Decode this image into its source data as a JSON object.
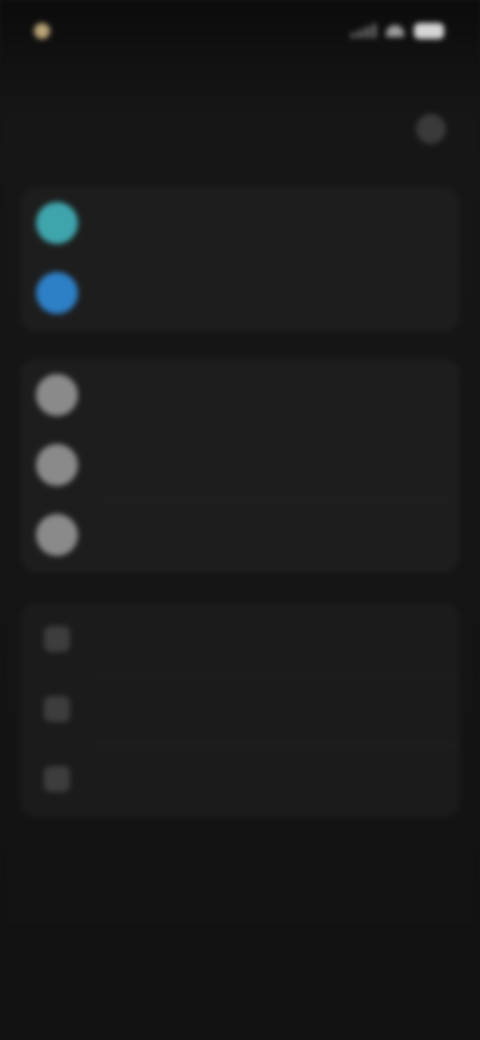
{
  "status_bar": {
    "time": "",
    "left_icon": "status-dot-icon",
    "right_icons": [
      "signal-icon",
      "wifi-icon",
      "battery-icon"
    ],
    "colors": {
      "dot": "#b9a476",
      "battery": "#d6d6d6"
    }
  },
  "nav": {
    "title": "",
    "action_icon": "more-icon"
  },
  "groups": [
    {
      "name": "accounts",
      "rows": [
        {
          "label": "",
          "icon": "avatar-teal",
          "color": "#3fa5ad"
        },
        {
          "label": "",
          "icon": "avatar-blue",
          "color": "#2d7fc6"
        }
      ]
    },
    {
      "name": "contacts",
      "rows": [
        {
          "label": "",
          "icon": "avatar-gray",
          "color": "#8a8a8a"
        },
        {
          "label": "",
          "icon": "avatar-gray",
          "color": "#8a8a8a"
        },
        {
          "label": "",
          "icon": "avatar-gray",
          "color": "#8a8a8a"
        }
      ]
    },
    {
      "name": "options",
      "rows": [
        {
          "label": "",
          "icon": "settings-icon"
        },
        {
          "label": "",
          "icon": "settings-icon"
        },
        {
          "label": "",
          "icon": "settings-icon"
        }
      ]
    }
  ]
}
